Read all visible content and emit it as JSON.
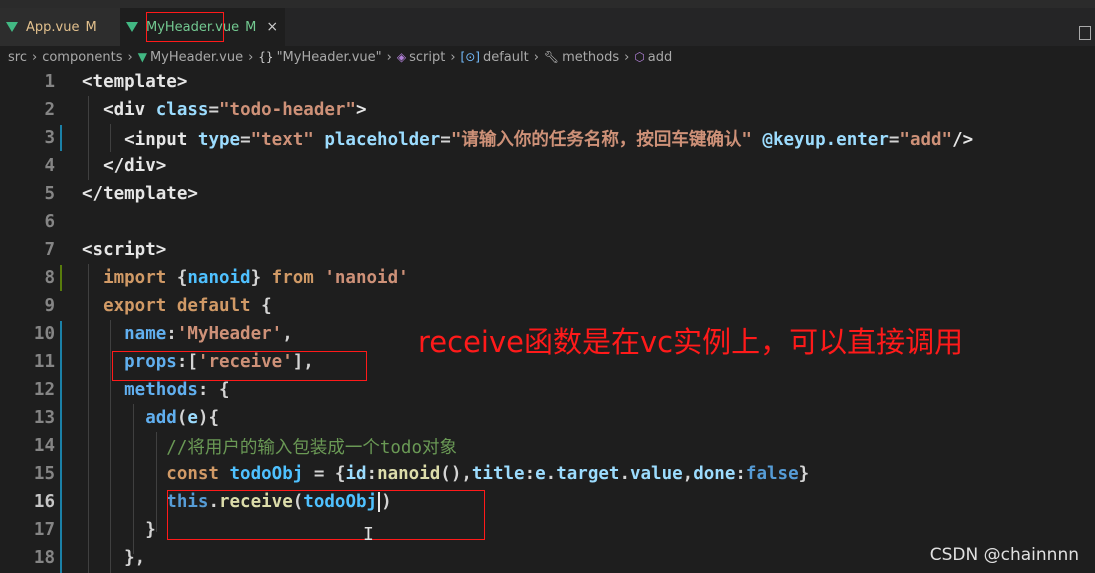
{
  "tabs": [
    {
      "name": "App.vue",
      "status": "M"
    },
    {
      "name": "MyHeader.vue",
      "status": "M",
      "close": "×"
    }
  ],
  "breadcrumb": {
    "src": "src",
    "components": "components",
    "file": "MyHeader.vue",
    "obj": "\"MyHeader.vue\"",
    "script": "script",
    "default": "default",
    "methods": "methods",
    "add": "add"
  },
  "lines": [
    {
      "n": "1",
      "tokens": [
        {
          "t": "<template>",
          "c": "tag"
        }
      ]
    },
    {
      "n": "2",
      "tokens": [
        {
          "t": "  <div ",
          "c": "tag"
        },
        {
          "t": "class",
          "c": "attr"
        },
        {
          "t": "=",
          "c": "plain"
        },
        {
          "t": "\"todo-header\"",
          "c": "str"
        },
        {
          "t": ">",
          "c": "tag"
        }
      ]
    },
    {
      "n": "3",
      "tokens": [
        {
          "t": "    <input ",
          "c": "tag"
        },
        {
          "t": "type",
          "c": "attr"
        },
        {
          "t": "=",
          "c": "plain"
        },
        {
          "t": "\"text\"",
          "c": "str"
        },
        {
          "t": " placeholder",
          "c": "attr"
        },
        {
          "t": "=",
          "c": "plain"
        },
        {
          "t": "\"请输入你的任务名称，按回车键确认\"",
          "c": "str"
        },
        {
          "t": " @keyup.enter",
          "c": "attr"
        },
        {
          "t": "=",
          "c": "plain"
        },
        {
          "t": "\"add\"",
          "c": "str"
        },
        {
          "t": "/>",
          "c": "tag"
        }
      ]
    },
    {
      "n": "4",
      "tokens": [
        {
          "t": "  </div>",
          "c": "tag"
        }
      ]
    },
    {
      "n": "5",
      "tokens": [
        {
          "t": "</template>",
          "c": "tag"
        }
      ]
    },
    {
      "n": "6",
      "tokens": []
    },
    {
      "n": "7",
      "tokens": [
        {
          "t": "<script>",
          "c": "tag"
        }
      ]
    },
    {
      "n": "8",
      "tokens": [
        {
          "t": "  import ",
          "c": "kw"
        },
        {
          "t": "{",
          "c": "plain"
        },
        {
          "t": "nanoid",
          "c": "var"
        },
        {
          "t": "} ",
          "c": "plain"
        },
        {
          "t": "from ",
          "c": "kw"
        },
        {
          "t": "'nanoid'",
          "c": "str"
        }
      ]
    },
    {
      "n": "9",
      "tokens": [
        {
          "t": "  export default ",
          "c": "kw"
        },
        {
          "t": "{",
          "c": "plain"
        }
      ]
    },
    {
      "n": "10",
      "tokens": [
        {
          "t": "    name",
          "c": "key"
        },
        {
          "t": ":",
          "c": "plain"
        },
        {
          "t": "'MyHeader'",
          "c": "str"
        },
        {
          "t": ",",
          "c": "plain"
        }
      ]
    },
    {
      "n": "11",
      "tokens": [
        {
          "t": "    props",
          "c": "key"
        },
        {
          "t": ":[",
          "c": "plain"
        },
        {
          "t": "'receive'",
          "c": "str"
        },
        {
          "t": "],",
          "c": "plain"
        }
      ]
    },
    {
      "n": "12",
      "tokens": [
        {
          "t": "    methods",
          "c": "key"
        },
        {
          "t": ": {",
          "c": "plain"
        }
      ]
    },
    {
      "n": "13",
      "tokens": [
        {
          "t": "      add",
          "c": "key"
        },
        {
          "t": "(",
          "c": "plain"
        },
        {
          "t": "e",
          "c": "attr"
        },
        {
          "t": "){",
          "c": "plain"
        }
      ]
    },
    {
      "n": "14",
      "tokens": [
        {
          "t": "        //将用户的输入包装成一个todo对象",
          "c": "cmt"
        }
      ]
    },
    {
      "n": "15",
      "tokens": [
        {
          "t": "        const ",
          "c": "kw"
        },
        {
          "t": "todoObj",
          "c": "var"
        },
        {
          "t": " = {",
          "c": "plain"
        },
        {
          "t": "id",
          "c": "attr"
        },
        {
          "t": ":",
          "c": "plain"
        },
        {
          "t": "nanoid",
          "c": "fn"
        },
        {
          "t": "(),",
          "c": "plain"
        },
        {
          "t": "title",
          "c": "attr"
        },
        {
          "t": ":",
          "c": "plain"
        },
        {
          "t": "e",
          "c": "attr"
        },
        {
          "t": ".",
          "c": "plain"
        },
        {
          "t": "target",
          "c": "attr"
        },
        {
          "t": ".",
          "c": "plain"
        },
        {
          "t": "value",
          "c": "attr"
        },
        {
          "t": ",",
          "c": "plain"
        },
        {
          "t": "done",
          "c": "attr"
        },
        {
          "t": ":",
          "c": "plain"
        },
        {
          "t": "false",
          "c": "this"
        },
        {
          "t": "}",
          "c": "plain"
        }
      ]
    },
    {
      "n": "16",
      "tokens": [
        {
          "t": "        this",
          "c": "this"
        },
        {
          "t": ".",
          "c": "plain"
        },
        {
          "t": "receive",
          "c": "fn"
        },
        {
          "t": "(",
          "c": "plain"
        },
        {
          "t": "todoObj",
          "c": "var"
        },
        {
          "t": "|",
          "c": "cursor"
        },
        {
          "t": ")",
          "c": "plain"
        }
      ]
    },
    {
      "n": "17",
      "tokens": [
        {
          "t": "      }",
          "c": "plain"
        }
      ]
    },
    {
      "n": "18",
      "tokens": [
        {
          "t": "    },",
          "c": "plain"
        }
      ]
    }
  ],
  "annotation": "receive函数是在vc实例上，可以直接调用",
  "watermark": "CSDN @chainnnn",
  "ibeam": "I",
  "colors": {
    "annotation": "#ff1a1a",
    "background": "#1e1e1e"
  }
}
